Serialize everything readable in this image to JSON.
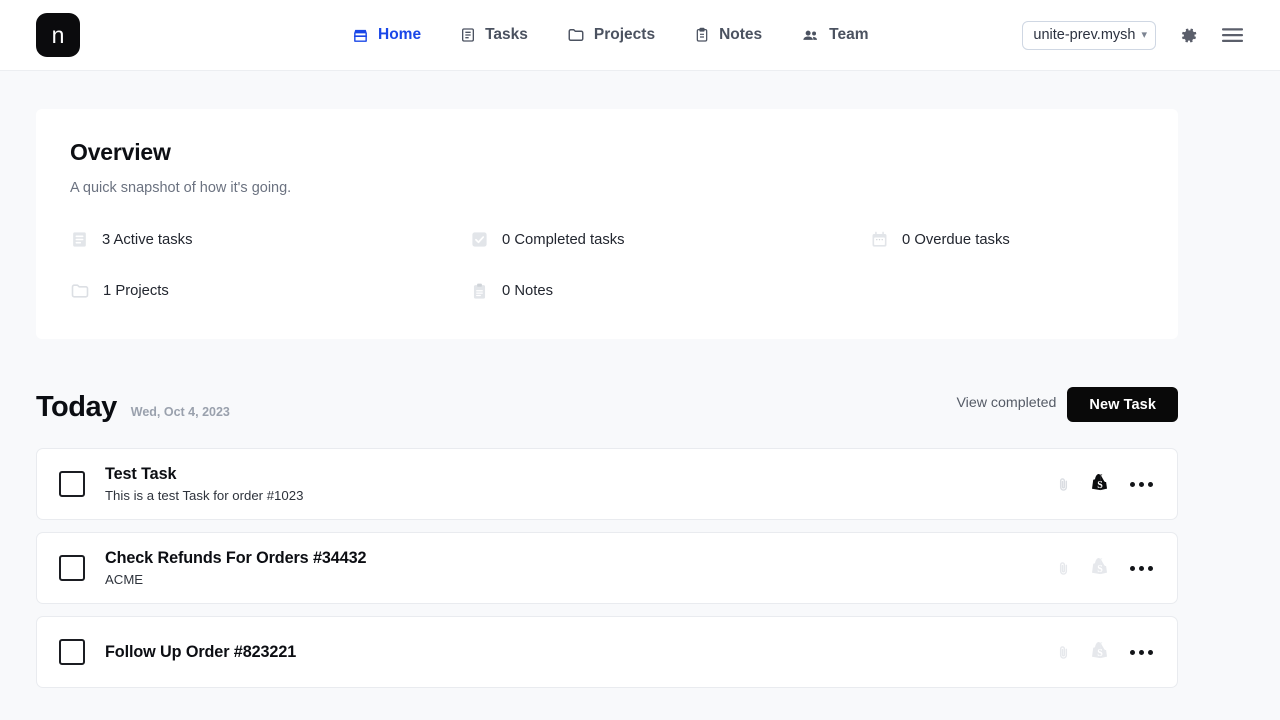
{
  "header": {
    "logo_text": "n",
    "nav": [
      {
        "label": "Home",
        "icon": "storefront-icon",
        "active": true
      },
      {
        "label": "Tasks",
        "icon": "tasks-list-icon",
        "active": false
      },
      {
        "label": "Projects",
        "icon": "folder-icon",
        "active": false
      },
      {
        "label": "Notes",
        "icon": "clipboard-icon",
        "active": false
      },
      {
        "label": "Team",
        "icon": "people-icon",
        "active": false
      }
    ],
    "org_select": {
      "value": "unite-prev.mysh",
      "caret": "chevron-down-icon"
    },
    "settings_icon": "gear-icon",
    "menu_icon": "hamburger-menu-icon",
    "accent_color": "#1a47e8"
  },
  "overview": {
    "title": "Overview",
    "subtitle": "A quick snapshot of how it's going.",
    "stats": [
      {
        "label": "3 Active tasks",
        "icon": "document-lines-icon"
      },
      {
        "label": "0 Completed tasks",
        "icon": "checkbox-checked-icon"
      },
      {
        "label": "0 Overdue tasks",
        "icon": "calendar-icon"
      },
      {
        "label": "1 Projects",
        "icon": "folder-icon"
      },
      {
        "label": "0 Notes",
        "icon": "clipboard-icon"
      }
    ]
  },
  "today": {
    "title": "Today",
    "date": "Wed, Oct 4, 2023",
    "view_completed_label": "View completed",
    "new_task_label": "New Task"
  },
  "tasks": [
    {
      "title": "Test Task",
      "subtitle": "This is a test Task for order #1023",
      "checked": false,
      "attachment_icon": "paperclip-icon",
      "shopify_icon": "shopify-bag-icon",
      "shopify_active": true,
      "more_icon": "more-options-icon"
    },
    {
      "title": "Check Refunds For Orders #34432",
      "subtitle": "ACME",
      "checked": false,
      "attachment_icon": "paperclip-icon",
      "shopify_icon": "shopify-bag-icon",
      "shopify_active": false,
      "more_icon": "more-options-icon"
    },
    {
      "title": "Follow Up Order #823221",
      "subtitle": "",
      "checked": false,
      "attachment_icon": "paperclip-icon",
      "shopify_icon": "shopify-bag-icon",
      "shopify_active": false,
      "more_icon": "more-options-icon"
    }
  ]
}
